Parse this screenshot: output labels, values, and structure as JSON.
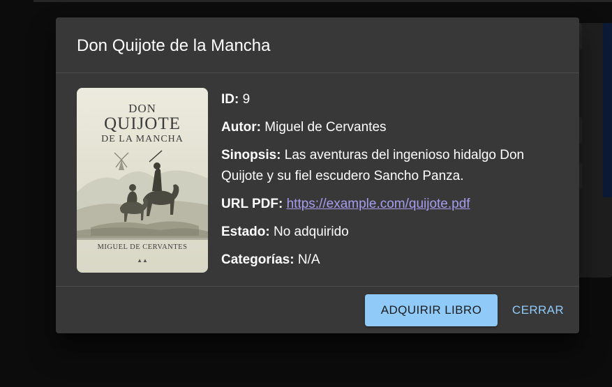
{
  "dialog": {
    "title": "Don Quijote de la Mancha",
    "cover": {
      "title_line1": "DON",
      "title_line2": "QUIJOTE",
      "title_line3": "DE LA MANCHA",
      "author": "MIGUEL DE CERVANTES"
    },
    "fields": {
      "id_label": "ID:",
      "id_value": "9",
      "author_label": "Autor:",
      "author_value": "Miguel de Cervantes",
      "synopsis_label": "Sinopsis:",
      "synopsis_value": "Las aventuras del ingenioso hidalgo Don Quijote y su fiel escudero Sancho Panza.",
      "pdf_label": "URL PDF:",
      "pdf_value": "https://example.com/quijote.pdf",
      "status_label": "Estado:",
      "status_value": "No adquirido",
      "categories_label": "Categorías:",
      "categories_value": "N/A"
    },
    "actions": {
      "acquire_label": "ADQUIRIR LIBRO",
      "close_label": "CERRAR"
    },
    "colors": {
      "primary": "#90caf9",
      "link": "#a79cf0",
      "surface": "#383838"
    }
  }
}
